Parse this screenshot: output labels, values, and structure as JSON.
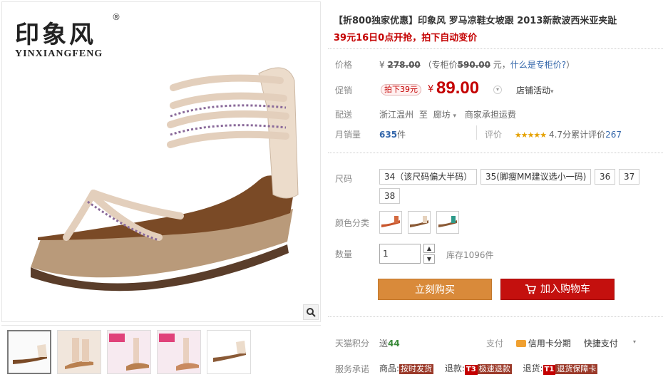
{
  "brand": {
    "name_cn": "印象风",
    "name_en": "YINXIANGFENG",
    "reg": "®"
  },
  "product": {
    "title": "【折800独家优惠】印象风 罗马凉鞋女坡跟 2013新款波西米亚夹趾",
    "subtitle": "39元16日0点开抢，拍下自动变价"
  },
  "price": {
    "label": "价格",
    "currency": "¥",
    "original": "278.00",
    "counter_prefix": "（专柜价",
    "counter_price": "590.00",
    "counter_suffix": "元，",
    "counter_link": "什么是专柜价?",
    "close_paren": "）"
  },
  "promo": {
    "label": "促销",
    "tag": "拍下39元",
    "currency": "¥",
    "value": "89.00",
    "store_activity": "店铺活动"
  },
  "shipping": {
    "label": "配送",
    "from": "浙江温州",
    "to_word": "至",
    "destination": "廊坊",
    "note": "商家承担运费"
  },
  "sales": {
    "label": "月销量",
    "count": "635",
    "unit": "件",
    "rating_label": "评价",
    "stars": "★★★★★",
    "score": "4.7分",
    "reviews_label": "累计评价",
    "reviews": "267"
  },
  "size": {
    "label": "尺码",
    "options": [
      "34（该尺码偏大半码）",
      "35(脚瘦MM建议选小一码)",
      "36",
      "37",
      "38"
    ]
  },
  "color": {
    "label": "颜色分类",
    "swatches": [
      "red-sandal",
      "beige-sandal",
      "green-sandal"
    ],
    "colors": [
      "#c8552c",
      "#e6d2bd",
      "#2e9a8a"
    ]
  },
  "quantity": {
    "label": "数量",
    "value": "1",
    "stock": "库存1096件",
    "up": "▲",
    "down": "▼"
  },
  "actions": {
    "buy_now": "立刻购买",
    "add_cart": "加入购物车"
  },
  "points": {
    "label": "天猫积分",
    "send": "送",
    "value": "44",
    "pay_label": "支付",
    "credit_card": "信用卡分期",
    "quick_pay": "快捷支付"
  },
  "service": {
    "label": "服务承诺",
    "goods": "商品:",
    "goods_tag": "按时发货",
    "refund": "退款:",
    "refund_badge": "T3",
    "refund_tag": "极速退款",
    "return": "退货:",
    "return_badge": "T1",
    "return_tag": "退货保障卡"
  }
}
